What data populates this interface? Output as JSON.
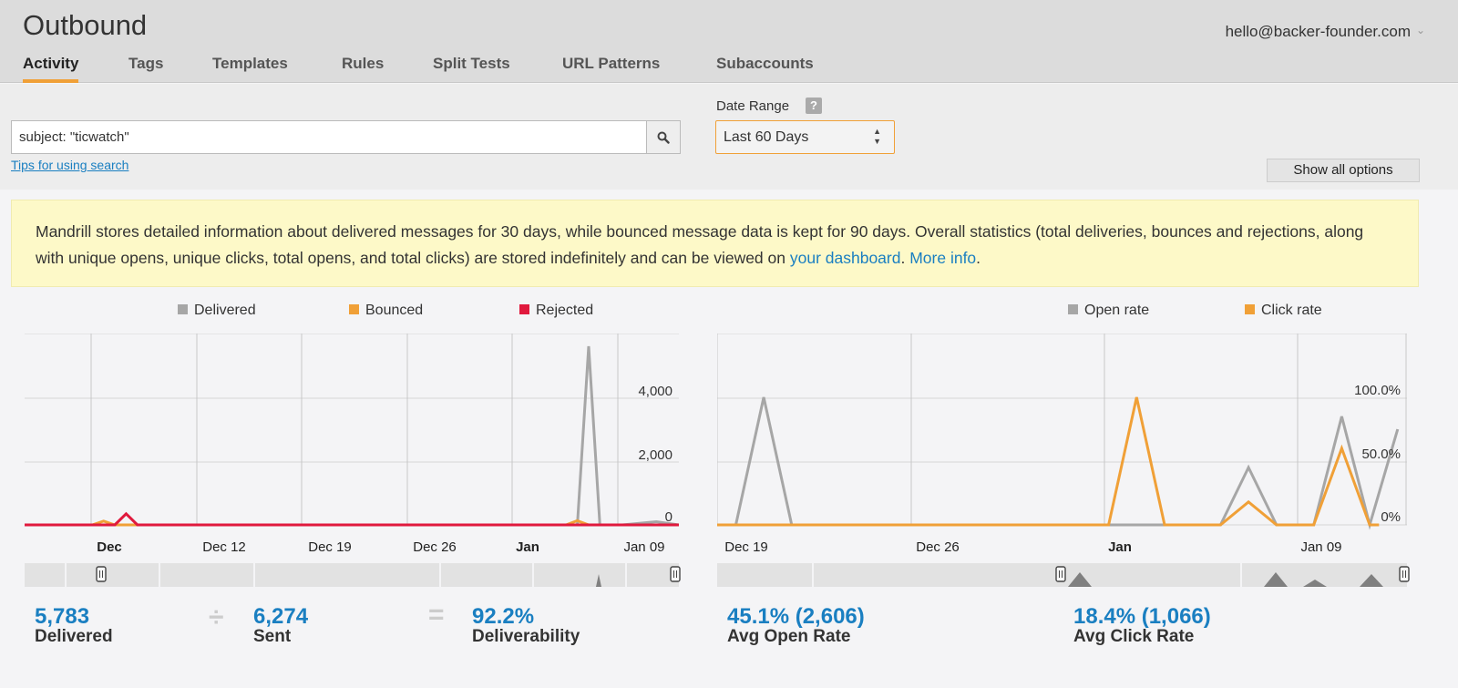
{
  "app": {
    "title": "Outbound",
    "account": "hello@backer-founder.com"
  },
  "tabs": [
    {
      "label": "Activity",
      "active": true
    },
    {
      "label": "Tags"
    },
    {
      "label": "Templates"
    },
    {
      "label": "Rules"
    },
    {
      "label": "Split Tests"
    },
    {
      "label": "URL Patterns"
    },
    {
      "label": "Subaccounts"
    }
  ],
  "search": {
    "value": "subject: \"ticwatch\"",
    "icon": "search-icon",
    "tips_label": "Tips for using search"
  },
  "date_range": {
    "label": "Date Range",
    "help": "?",
    "value": "Last 60 Days"
  },
  "show_all_label": "Show all options",
  "notice": {
    "text": "Mandrill stores detailed information about delivered messages for 30 days, while bounced message data is kept for 90 days. Overall statistics (total deliveries, bounces and rejections, along with unique opens, unique clicks, total opens, and total clicks) are stored indefinitely and can be viewed on ",
    "link1": "your dashboard",
    "mid": ". ",
    "link2": "More info",
    "end": "."
  },
  "colors": {
    "delivered": "#a6a6a6",
    "bounced": "#f0a037",
    "rejected": "#e0193d",
    "open": "#a6a6a6",
    "click": "#f0a037",
    "link": "#1a7fc1",
    "accent": "#f0a037"
  },
  "chart_data": [
    {
      "type": "line",
      "series": [
        {
          "name": "Delivered",
          "values": [
            [
              0,
              0
            ],
            [
              6,
              0
            ],
            [
              9,
              0
            ],
            [
              12,
              0
            ],
            [
              21,
              0
            ],
            [
              40,
              0
            ],
            [
              49,
              0
            ],
            [
              50,
              5600
            ],
            [
              51,
              0
            ],
            [
              53,
              0
            ],
            [
              56,
              100
            ],
            [
              58,
              0
            ]
          ]
        },
        {
          "name": "Bounced",
          "values": [
            [
              0,
              0
            ],
            [
              6,
              0
            ],
            [
              7,
              120
            ],
            [
              8,
              0
            ],
            [
              10,
              0
            ],
            [
              48,
              0
            ],
            [
              49,
              130
            ],
            [
              50,
              0
            ],
            [
              58,
              0
            ]
          ]
        },
        {
          "name": "Rejected",
          "values": [
            [
              0,
              0
            ],
            [
              8,
              0
            ],
            [
              9,
              350
            ],
            [
              10,
              0
            ],
            [
              58,
              0
            ]
          ]
        }
      ],
      "x_ticks": [
        "Dec",
        "Dec 12",
        "Dec 19",
        "Dec 26",
        "Jan",
        "Jan 09"
      ],
      "x_ticks_bold": [
        "Dec",
        "Jan"
      ],
      "y_ticks": [
        "0",
        "2,000",
        "4,000"
      ],
      "ylim": [
        0,
        6000
      ]
    },
    {
      "type": "line",
      "series": [
        {
          "name": "Open rate",
          "values": [
            [
              0,
              0
            ],
            [
              1,
              0
            ],
            [
              2.5,
              100
            ],
            [
              4,
              0
            ],
            [
              6,
              0
            ],
            [
              13,
              0
            ],
            [
              21,
              0
            ],
            [
              22.5,
              0
            ],
            [
              24,
              0
            ],
            [
              25.5,
              0
            ],
            [
              27,
              0
            ],
            [
              28.5,
              45
            ],
            [
              30,
              0
            ],
            [
              32,
              0
            ],
            [
              33.5,
              85
            ],
            [
              35,
              0
            ],
            [
              36.5,
              75
            ]
          ]
        },
        {
          "name": "Click rate",
          "values": [
            [
              0,
              0
            ],
            [
              13,
              0
            ],
            [
              21,
              0
            ],
            [
              22.5,
              100
            ],
            [
              24,
              0
            ],
            [
              25.5,
              0
            ],
            [
              27,
              0
            ],
            [
              28.5,
              18
            ],
            [
              30,
              0
            ],
            [
              32,
              0
            ],
            [
              33.5,
              60
            ],
            [
              35,
              0
            ],
            [
              35.5,
              0
            ]
          ]
        }
      ],
      "x_ticks": [
        "Dec 19",
        "Dec 26",
        "Jan",
        "Jan 09"
      ],
      "x_ticks_bold": [
        "Jan"
      ],
      "y_ticks": [
        "0%",
        "50.0%",
        "100.0%"
      ],
      "ylim": [
        0,
        150
      ]
    }
  ],
  "stats": {
    "delivered": {
      "value": "5,783",
      "label": "Delivered"
    },
    "divide": "÷",
    "sent": {
      "value": "6,274",
      "label": "Sent"
    },
    "equals": "=",
    "deliverability": {
      "value": "92.2%",
      "label": "Deliverability"
    },
    "open_rate": {
      "value": "45.1% (2,606)",
      "label": "Avg Open Rate"
    },
    "click_rate": {
      "value": "18.4% (1,066)",
      "label": "Avg Click Rate"
    }
  }
}
